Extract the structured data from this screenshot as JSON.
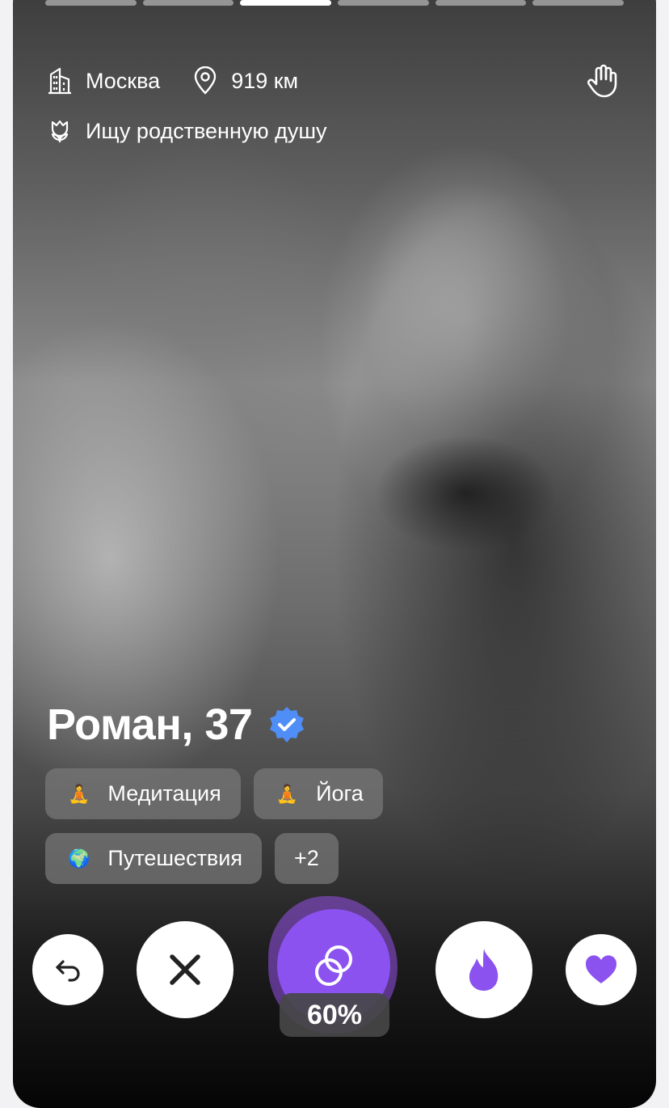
{
  "colors": {
    "accent": "#8c52f0",
    "accent_glow": "#9650e6",
    "verified": "#4f8ef7",
    "white": "#ffffff"
  },
  "photo": {
    "story_progress": {
      "total": 6,
      "active": 3
    }
  },
  "header": {
    "city": "Москва",
    "city_icon": "building-icon",
    "distance": "919 км",
    "distance_icon": "location-pin-icon",
    "goal": "Ищу родственную душу",
    "goal_icon": "tulip-icon",
    "wave_icon": "hand-wave-icon"
  },
  "profile": {
    "name_age": "Роман, 37",
    "verified_icon": "verified-badge-icon"
  },
  "interests": [
    {
      "emoji": "🧘",
      "label": "Медитация"
    },
    {
      "emoji": "🧘",
      "label": "Йога"
    },
    {
      "emoji": "🌍",
      "label": "Путешествия"
    }
  ],
  "interests_more": "+2",
  "actions": {
    "undo_icon": "undo-arrow-icon",
    "dislike_icon": "close-icon",
    "match_icon": "rings-icon",
    "match_percent": "60%",
    "superlike_icon": "flame-icon",
    "like_icon": "heart-icon"
  }
}
